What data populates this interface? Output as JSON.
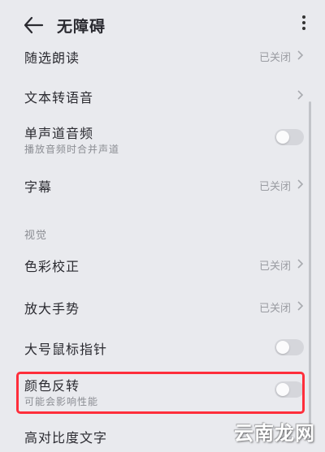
{
  "header": {
    "title": "无障碍",
    "back_icon": "back-arrow-icon",
    "more_icon": "more-vertical-icon"
  },
  "items": {
    "select_to_speak": {
      "label": "随选朗读",
      "value": "已关闭"
    },
    "text_to_speech": {
      "label": "文本转语音"
    },
    "mono_audio": {
      "label": "单声道音频",
      "sub": "播放音频时合并声道",
      "enabled": false
    },
    "captions": {
      "label": "字幕",
      "value": "已关闭"
    },
    "section_vision": "视觉",
    "color_correction": {
      "label": "色彩校正",
      "value": "已关闭"
    },
    "magnification": {
      "label": "放大手势",
      "value": "已关闭"
    },
    "large_pointer": {
      "label": "大号鼠标指针",
      "enabled": false
    },
    "color_inversion": {
      "label": "颜色反转",
      "sub": "可能会影响性能",
      "enabled": false
    },
    "high_contrast": {
      "label": "高对比度文字"
    }
  },
  "watermark": "云南龙网",
  "colors": {
    "highlight": "#ff2e3b",
    "background": "#e9eaee"
  }
}
